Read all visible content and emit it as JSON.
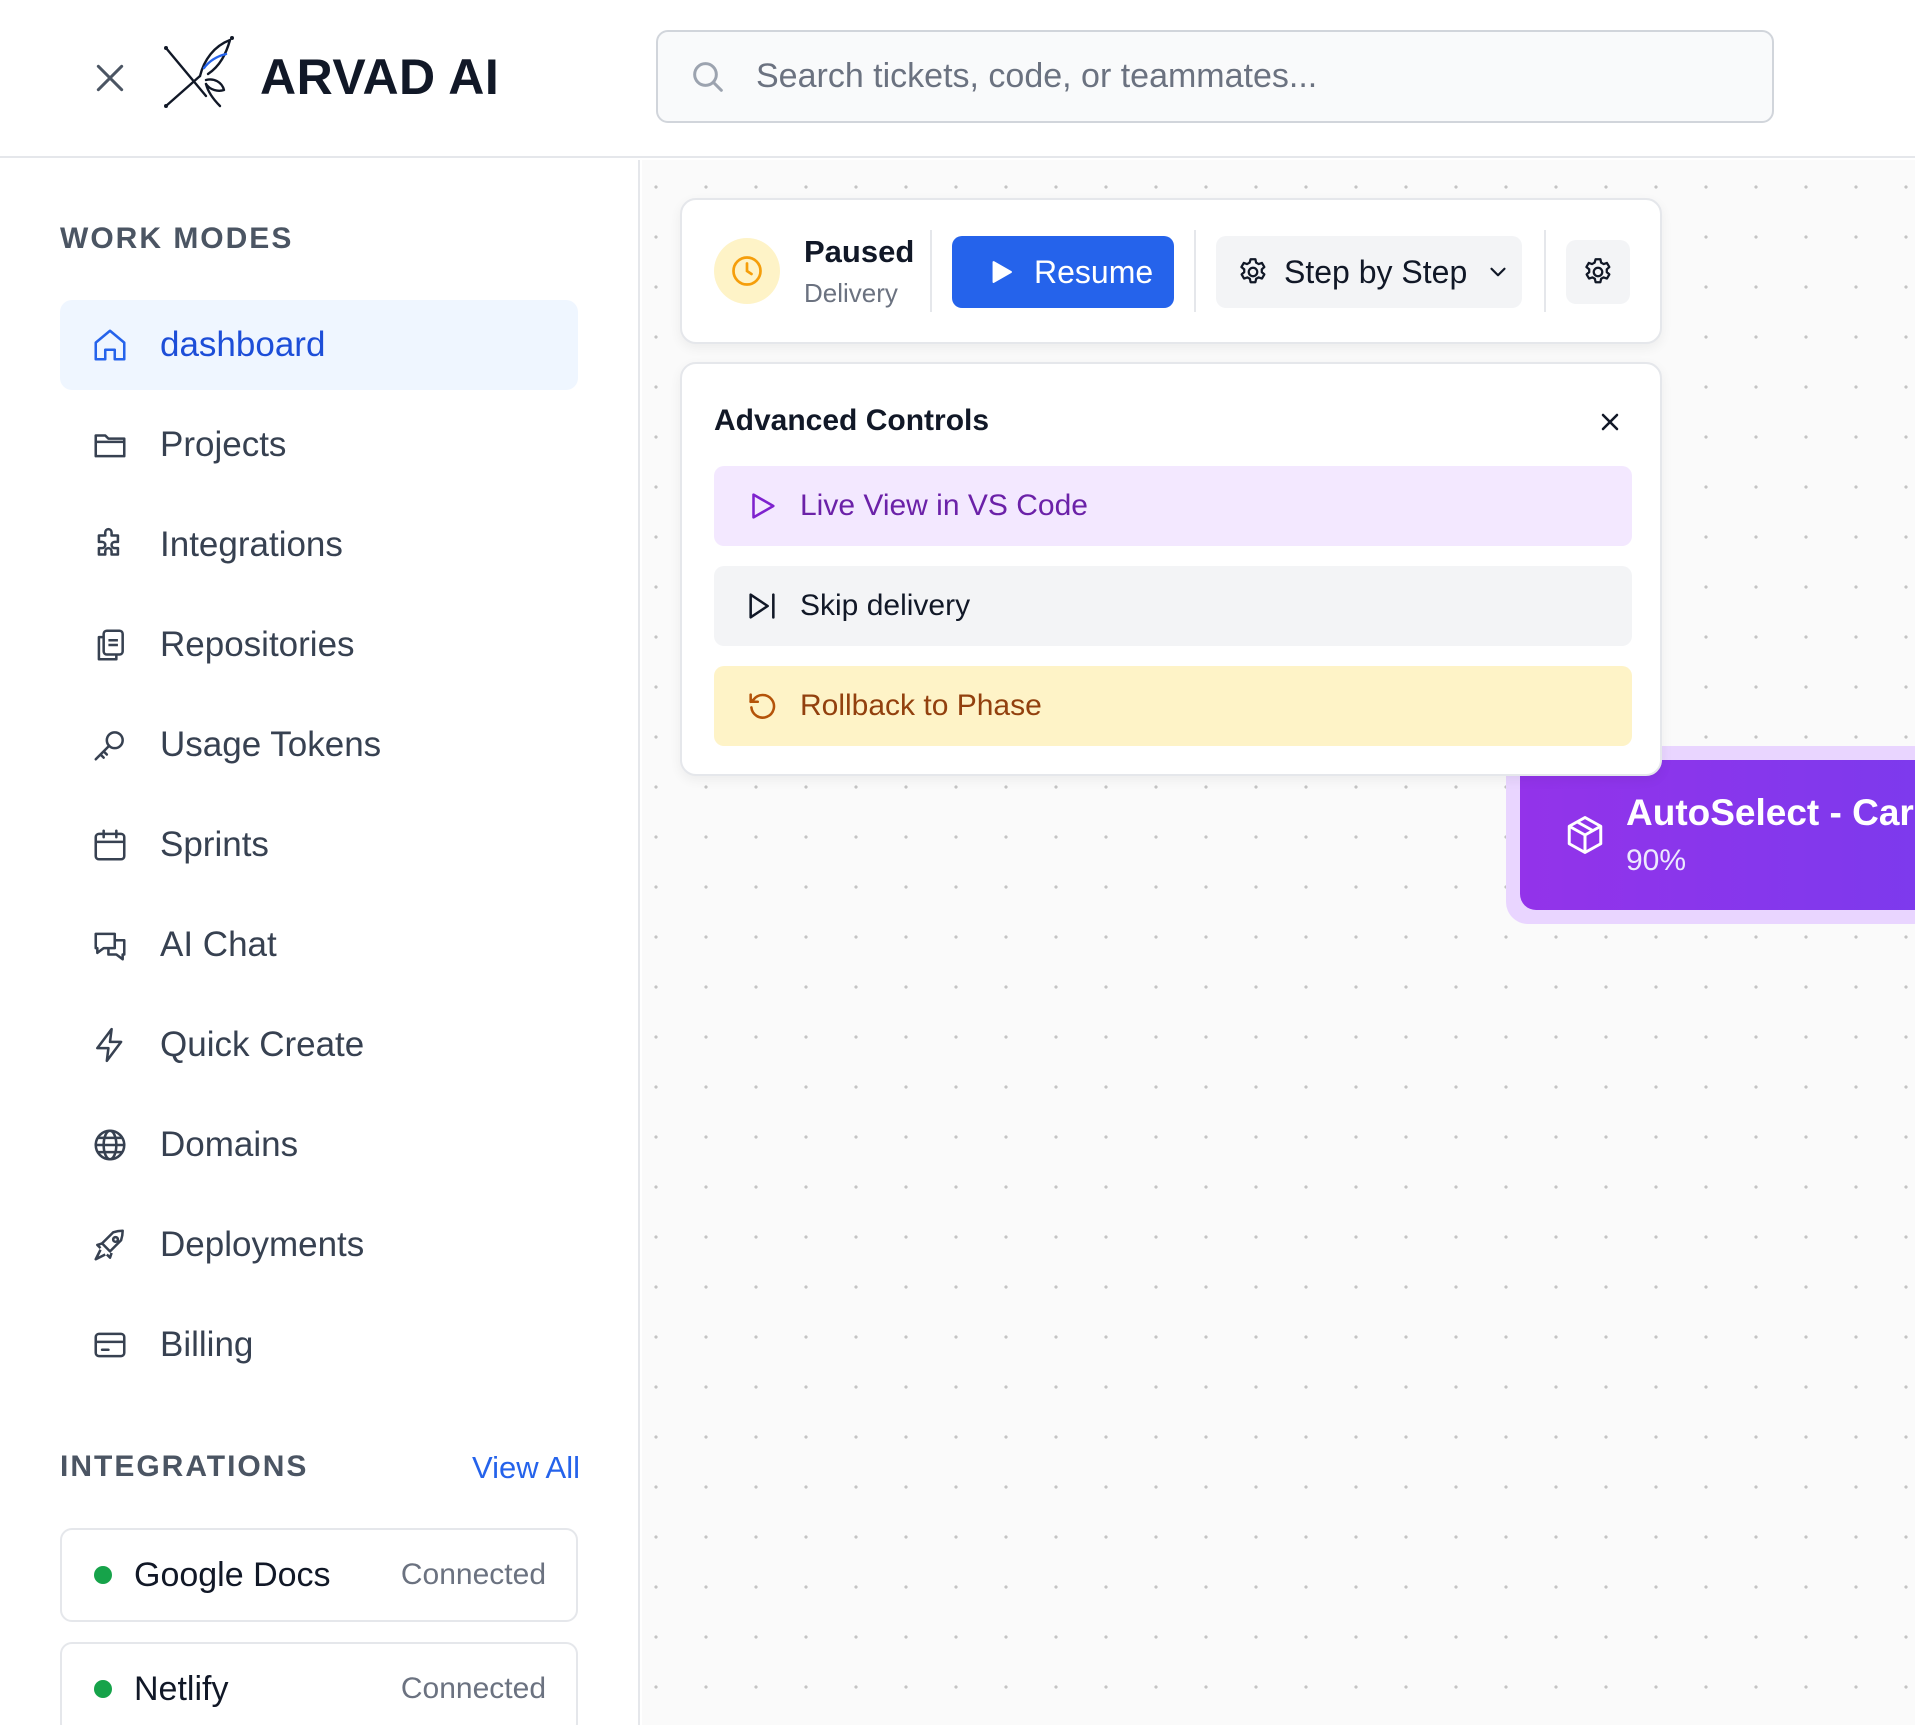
{
  "header": {
    "brand": "ARVAD AI",
    "search_placeholder": "Search tickets, code, or teammates..."
  },
  "sidebar": {
    "work_modes_title": "WORK MODES",
    "items": [
      {
        "label": "dashboard",
        "icon": "home-icon",
        "active": true
      },
      {
        "label": "Projects",
        "icon": "folder-icon"
      },
      {
        "label": "Integrations",
        "icon": "puzzle-icon"
      },
      {
        "label": "Repositories",
        "icon": "clipboard-copy-icon"
      },
      {
        "label": "Usage Tokens",
        "icon": "key-icon"
      },
      {
        "label": "Sprints",
        "icon": "calendar-icon"
      },
      {
        "label": "AI Chat",
        "icon": "chat-bubbles-icon"
      },
      {
        "label": "Quick Create",
        "icon": "lightning-icon"
      },
      {
        "label": "Domains",
        "icon": "globe-icon"
      },
      {
        "label": "Deployments",
        "icon": "rocket-icon"
      },
      {
        "label": "Billing",
        "icon": "credit-card-icon"
      }
    ],
    "integrations_title": "INTEGRATIONS",
    "view_all": "View All",
    "integrations": [
      {
        "name": "Google Docs",
        "status": "Connected"
      },
      {
        "name": "Netlify",
        "status": "Connected"
      }
    ]
  },
  "toolbar": {
    "status_title": "Paused",
    "status_sub": "Delivery",
    "resume_label": "Resume",
    "mode_label": "Step by Step"
  },
  "advanced": {
    "title": "Advanced Controls",
    "live_view": "Live View in VS Code",
    "skip": "Skip delivery",
    "rollback": "Rollback to Phase"
  },
  "node": {
    "title": "AutoSelect - Car",
    "progress": "90%"
  },
  "colors": {
    "accent": "#2563eb",
    "node": "#9333ea",
    "paused": "#f59e0b",
    "connected": "#16a34a"
  }
}
